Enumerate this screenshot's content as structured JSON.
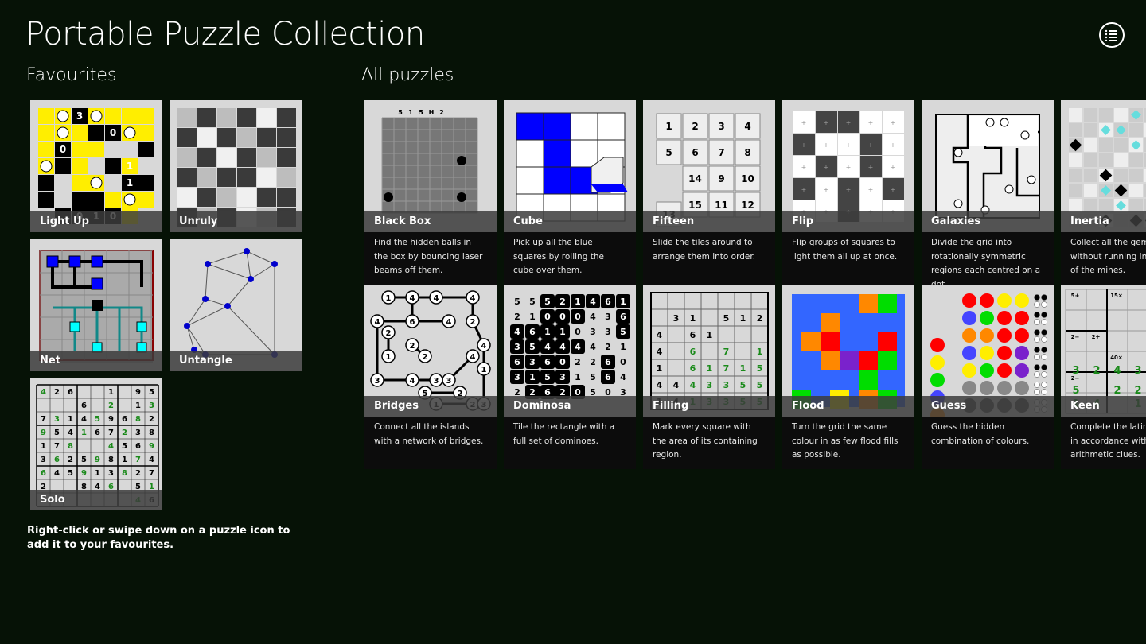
{
  "app": {
    "title": "Portable Puzzle Collection"
  },
  "header": {
    "menu_icon": "list-icon"
  },
  "favourites": {
    "title": "Favourites",
    "items": [
      {
        "name": "Light Up"
      },
      {
        "name": "Unruly"
      },
      {
        "name": "Net"
      },
      {
        "name": "Untangle"
      },
      {
        "name": "Solo"
      }
    ],
    "hint": "Right-click or swipe down on a puzzle icon to add it to your favourites."
  },
  "all_puzzles": {
    "title": "All puzzles",
    "items": [
      {
        "name": "Black Box",
        "description": "Find the hidden balls in the box by bouncing laser beams off them."
      },
      {
        "name": "Cube",
        "description": "Pick up all the blue squares by rolling the cube over them."
      },
      {
        "name": "Fifteen",
        "description": "Slide the tiles around to arrange them into order."
      },
      {
        "name": "Flip",
        "description": "Flip groups of squares to light them all up at once."
      },
      {
        "name": "Galaxies",
        "description": "Divide the grid into rotationally symmetric regions each centred on a dot."
      },
      {
        "name": "Inertia",
        "description": "Collect all the gems without running into any of the mines."
      },
      {
        "name": "Bridges",
        "description": "Connect all the islands with a network of bridges."
      },
      {
        "name": "Dominosa",
        "description": "Tile the rectangle with a full set of dominoes."
      },
      {
        "name": "Filling",
        "description": "Mark every square with the area of its containing region."
      },
      {
        "name": "Flood",
        "description": "Turn the grid the same colour in as few flood fills as possible."
      },
      {
        "name": "Guess",
        "description": "Guess the hidden combination of colours."
      },
      {
        "name": "Keen",
        "description": "Complete the latin square in accordance with the arithmetic clues."
      }
    ]
  },
  "thumbs": {
    "fifteen": [
      "1",
      "2",
      "3",
      "4",
      "5",
      "6",
      "7",
      "8",
      "",
      "14",
      "9",
      "10",
      "13",
      "15",
      "11",
      "12"
    ],
    "blackbox_top": [
      "5",
      "1",
      "5",
      "H",
      "2"
    ],
    "lightup": [
      "3",
      "0",
      "0",
      "1",
      "1",
      "0",
      "1",
      "0"
    ],
    "solo_rows": [
      "4 2 6 _ _ 1 _ 9 5",
      "_ _ _ 6 _ 2 _ 1 3",
      "7 3 1 4 5 9 6 8 2",
      "9 5 4 1 6 7 2 3 8",
      "1 7 8 _ _ 4 5 6 9",
      "3 6 2 5 9 8 1 7 4",
      "6 4 5 9 1 3 8 2 7",
      "2 _ _ 8 4 6 _ 5 1",
      "_ _ _ _ _ _ _ 4 6"
    ],
    "dominosa_rows": [
      "5 5 5 2 1 4 6 1",
      "2 1 0 0 0 4 3 6",
      "4 6 1 1 0 3 3 5",
      "3 5 4 4 4 4 2 1",
      "6 3 6 0 2 2 6 0",
      "3 1 5 3 1 5 6 4",
      "2 2 6 2 0 5 0 3"
    ],
    "filling_rows": [
      "_ _ _ _ _ _ _",
      "_ 3 1 _ 5 1 2",
      "4 _ 6 1 _ _ _",
      "4 _ 6 _ 7 _ 1",
      "1 _ 6 1 7 1 5",
      "4 4 4 3 3 5 5",
      "1 4 1 3 3 5 5"
    ],
    "bridges_nodes": [
      "1",
      "4",
      "4",
      "4",
      "4",
      "6",
      "2",
      "4",
      "2",
      "2",
      "1",
      "2",
      "4",
      "4",
      "1",
      "3",
      "3",
      "5",
      "2",
      "1",
      "2",
      "3",
      "4",
      "3"
    ],
    "keen_cages": [
      "5+",
      "15×",
      "3−",
      "2−",
      "2÷",
      "40×",
      "2−"
    ],
    "keen_values": [
      "2",
      "4",
      "5",
      "2",
      "2",
      "4",
      "1",
      "1",
      "3",
      "3",
      "3",
      "5",
      "1",
      "5",
      "5"
    ]
  },
  "colors": {
    "background": "#061206",
    "tile_bg": "#d8d8d8",
    "label_overlay": "#3c3c3c",
    "description_bg": "#0c0c0c",
    "lightup_yellow": "#ffee00",
    "cube_blue": "#0000ff",
    "net_teal": "#118888"
  }
}
